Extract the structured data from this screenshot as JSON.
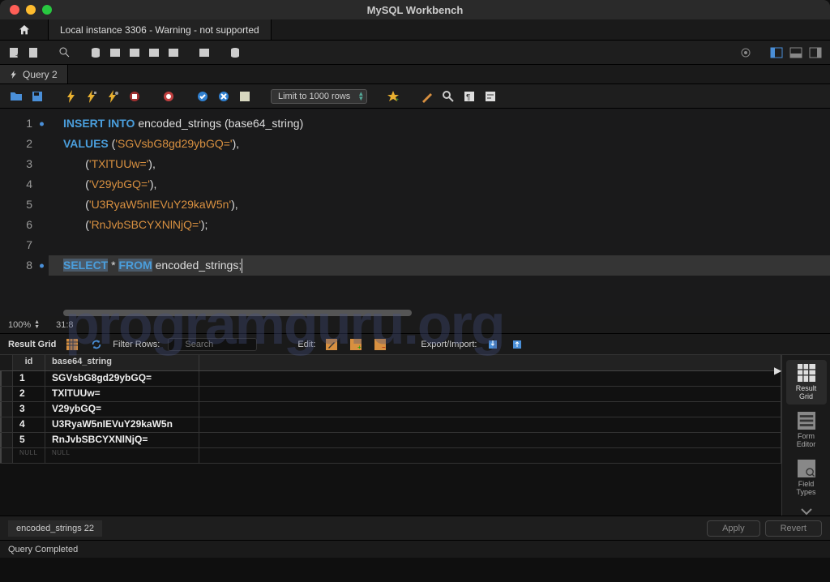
{
  "window": {
    "title": "MySQL Workbench"
  },
  "connectionTab": {
    "label": "Local instance 3306 - Warning - not supported"
  },
  "queryTab": {
    "label": "Query 2"
  },
  "limitSelect": {
    "value": "Limit to 1000 rows"
  },
  "editor": {
    "lines": [
      {
        "n": "1",
        "mark": true
      },
      {
        "n": "2",
        "mark": false
      },
      {
        "n": "3",
        "mark": false
      },
      {
        "n": "4",
        "mark": false
      },
      {
        "n": "5",
        "mark": false
      },
      {
        "n": "6",
        "mark": false
      },
      {
        "n": "7",
        "mark": false
      },
      {
        "n": "8",
        "mark": true
      }
    ],
    "tokens": {
      "l1_kw1": "INSERT",
      "l1_kw2": "INTO",
      "l1_id": " encoded_strings ",
      "l1_paren": "(base64_string)",
      "l2_kw": "VALUES",
      "l2_s": "'SGVsbG8gd29ybGQ='",
      "l3_s": "'TXlTUUw='",
      "l4_s": "'V29ybGQ='",
      "l5_s": "'U3RyaW5nIEVuY29kaW5n'",
      "l6_s": "'RnJvbSBCYXNlNjQ='",
      "l8_kw1": "SELECT",
      "l8_star": " * ",
      "l8_kw2": "FROM",
      "l8_id": " encoded_strings;"
    }
  },
  "editorStatus": {
    "zoom": "100%",
    "pos": "31:8"
  },
  "resultToolbar": {
    "label": "Result Grid",
    "filterLabel": "Filter Rows:",
    "searchPlaceholder": "Search",
    "editLabel": "Edit:",
    "exportLabel": "Export/Import:"
  },
  "grid": {
    "columns": {
      "id": "id",
      "val": "base64_string"
    },
    "rows": [
      {
        "id": "1",
        "val": "SGVsbG8gd29ybGQ="
      },
      {
        "id": "2",
        "val": "TXlTUUw="
      },
      {
        "id": "3",
        "val": "V29ybGQ="
      },
      {
        "id": "4",
        "val": "U3RyaW5nIEVuY29kaW5n"
      },
      {
        "id": "5",
        "val": "RnJvbSBCYXNlNjQ="
      }
    ],
    "nullLabel": "NULL"
  },
  "sideView": {
    "resultGrid": "Result\nGrid",
    "formEditor": "Form\nEditor",
    "fieldTypes": "Field\nTypes"
  },
  "bottomTab": {
    "label": "encoded_strings 22"
  },
  "buttons": {
    "apply": "Apply",
    "revert": "Revert"
  },
  "footer": {
    "status": "Query Completed"
  },
  "watermark": "programguru.org"
}
